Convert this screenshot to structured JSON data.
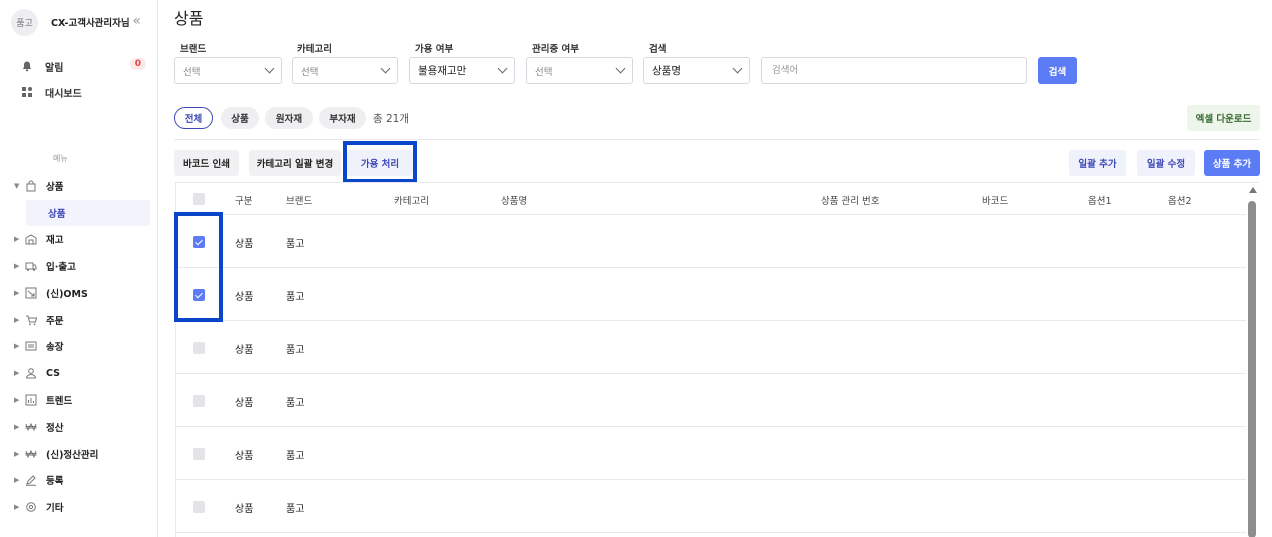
{
  "sidebar": {
    "avatar_text": "품고",
    "company": "CX-고객사관리자님",
    "collapse_icon": "«",
    "top_items": [
      {
        "label": "알림",
        "icon": "bell-icon",
        "badge": "0"
      },
      {
        "label": "대시보드",
        "icon": "dashboard-icon"
      }
    ],
    "menu_title": "메뉴",
    "menu": [
      {
        "label": "상품",
        "icon": "bag-icon",
        "expanded": true
      },
      {
        "label": "재고",
        "icon": "warehouse-icon"
      },
      {
        "label": "입·출고",
        "icon": "truck-icon"
      },
      {
        "label": "(신)OMS",
        "icon": "oms-icon"
      },
      {
        "label": "주문",
        "icon": "cart-icon"
      },
      {
        "label": "송장",
        "icon": "invoice-icon"
      },
      {
        "label": "CS",
        "icon": "person-icon"
      },
      {
        "label": "트렌드",
        "icon": "chart-icon"
      },
      {
        "label": "정산",
        "icon": "won-icon"
      },
      {
        "label": "(신)정산관리",
        "icon": "won-icon"
      },
      {
        "label": "등록",
        "icon": "pencil-icon"
      },
      {
        "label": "기타",
        "icon": "gear-icon"
      }
    ],
    "submenu_active": "상품"
  },
  "page": {
    "title": "상품"
  },
  "filters": {
    "brand": {
      "label": "브랜드",
      "value": "선택"
    },
    "category": {
      "label": "카테고리",
      "value": "선택"
    },
    "availability": {
      "label": "가용 여부",
      "value": "불용재고만"
    },
    "managed": {
      "label": "관리중 여부",
      "value": "선택"
    },
    "search": {
      "label": "검색",
      "field": "상품명",
      "placeholder": "검색어",
      "button": "검색"
    }
  },
  "tabs": {
    "items": [
      "전체",
      "상품",
      "원자재",
      "부자재"
    ],
    "active": 0,
    "total": "총 21개"
  },
  "excel_button": "엑셀 다운로드",
  "actions": {
    "barcode": "바코드 인쇄",
    "category_bulk": "카테고리 일괄 변경",
    "availability": "가용 처리",
    "bulk_add": "일괄 추가",
    "bulk_edit": "일괄 수정",
    "add_product": "상품 추가"
  },
  "table": {
    "columns": [
      "구분",
      "브랜드",
      "카테고리",
      "상품명",
      "상품 관리 번호",
      "바코드",
      "옵션1",
      "옵션2"
    ],
    "rows": [
      {
        "checked": true,
        "type": "상품",
        "brand": "품고"
      },
      {
        "checked": true,
        "type": "상품",
        "brand": "품고"
      },
      {
        "checked": false,
        "type": "상품",
        "brand": "품고"
      },
      {
        "checked": false,
        "type": "상품",
        "brand": "품고"
      },
      {
        "checked": false,
        "type": "상품",
        "brand": "품고"
      },
      {
        "checked": false,
        "type": "상품",
        "brand": "품고"
      }
    ]
  },
  "colors": {
    "accent": "#5b7cf4",
    "highlight": "#0a46c9",
    "active_text": "#3e49b8"
  }
}
